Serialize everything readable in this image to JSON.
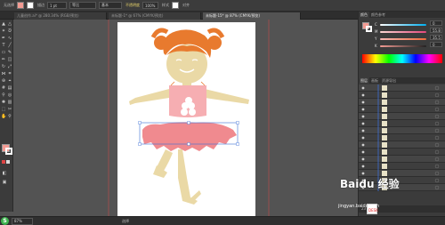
{
  "control_bar": {
    "selection_label": "无选择",
    "stroke_label": "描边",
    "stroke_value": "1 pt",
    "profile_label": "等比",
    "brush_label": "基本",
    "opacity_label": "不透明度",
    "opacity_value": "100%",
    "style_label": "样式",
    "align_label": "对齐"
  },
  "doc_tabs": [
    {
      "label": "儿童创作.ai* @ 280.34% (RGB/预览)",
      "active": false
    },
    {
      "label": "未标题-1* @ 67% (CMYK/预览)",
      "active": false
    },
    {
      "label": "未标题-15* @ 87% (CMYK/预览)",
      "active": true
    }
  ],
  "colors": {
    "fill": "#f39b93",
    "stroke": "#ffffff",
    "hair": "#e87a2e",
    "skin": "#ead9a6",
    "dress": "#f08a8f",
    "dress_top": "#f6aeb2",
    "accent_red": "#e02020"
  },
  "panels": {
    "color_tabs": [
      "颜色",
      "颜色参考"
    ],
    "channels": [
      {
        "label": "C",
        "value": "0"
      },
      {
        "label": "M",
        "value": "55.8"
      },
      {
        "label": "Y",
        "value": "35.5"
      },
      {
        "label": "K",
        "value": "0"
      }
    ],
    "layer_tabs": [
      "图层",
      "画板",
      "资源导出"
    ],
    "layers_count_text": "23 个图层"
  },
  "status_bar": {
    "zoom": "87%",
    "tool_name": "选择"
  },
  "watermark": {
    "brand": "Baidu 经验",
    "url": "jingyan.baidu.com"
  }
}
